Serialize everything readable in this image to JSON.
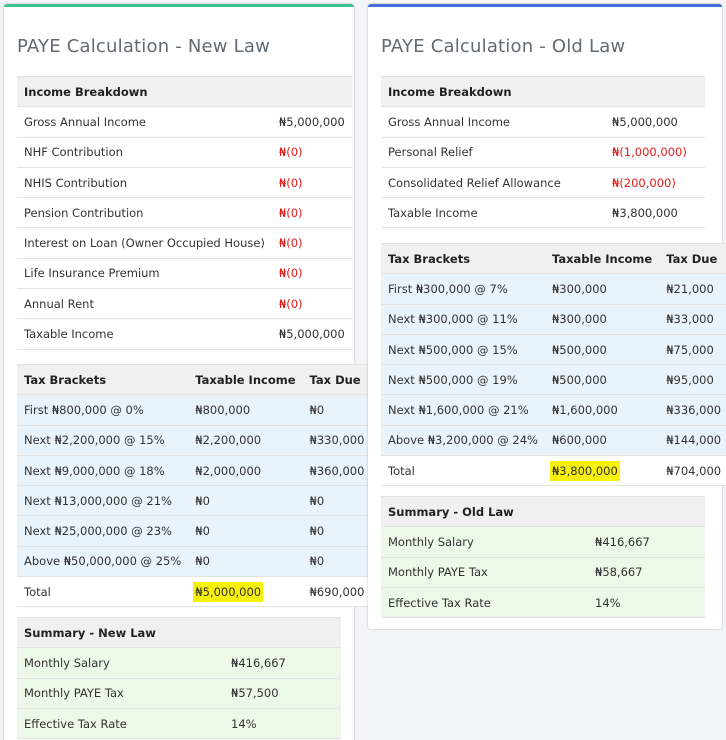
{
  "new_law": {
    "title": "PAYE Calculation - New Law",
    "income": {
      "header": "Income Breakdown",
      "rows": [
        {
          "label": "Gross Annual Income",
          "value": "₦5,000,000"
        },
        {
          "label": "NHF Contribution",
          "value": "₦(0)"
        },
        {
          "label": "NHIS Contribution",
          "value": "₦(0)"
        },
        {
          "label": "Pension Contribution",
          "value": "₦(0)"
        },
        {
          "label": "Interest on Loan (Owner Occupied House)",
          "value": "₦(0)"
        },
        {
          "label": "Life Insurance Premium",
          "value": "₦(0)"
        },
        {
          "label": "Annual Rent",
          "value": "₦(0)"
        },
        {
          "label": "Taxable Income",
          "value": "₦5,000,000"
        }
      ]
    },
    "brackets": {
      "headers": [
        "Tax Brackets",
        "Taxable Income",
        "Tax Due"
      ],
      "rows": [
        {
          "bracket": "First ₦800,000 @ 0%",
          "taxable": "₦800,000",
          "due": "₦0"
        },
        {
          "bracket": "Next ₦2,200,000 @ 15%",
          "taxable": "₦2,200,000",
          "due": "₦330,000"
        },
        {
          "bracket": "Next ₦9,000,000 @ 18%",
          "taxable": "₦2,000,000",
          "due": "₦360,000"
        },
        {
          "bracket": "Next ₦13,000,000 @ 21%",
          "taxable": "₦0",
          "due": "₦0"
        },
        {
          "bracket": "Next ₦25,000,000 @ 23%",
          "taxable": "₦0",
          "due": "₦0"
        },
        {
          "bracket": "Above ₦50,000,000 @ 25%",
          "taxable": "₦0",
          "due": "₦0"
        }
      ],
      "total": {
        "label": "Total",
        "taxable": "₦5,000,000",
        "due": "₦690,000"
      }
    },
    "summary": {
      "header": "Summary - New Law",
      "rows": [
        {
          "label": "Monthly Salary",
          "value": "₦416,667"
        },
        {
          "label": "Monthly PAYE Tax",
          "value": "₦57,500"
        },
        {
          "label": "Effective Tax Rate",
          "value": "14%"
        }
      ]
    }
  },
  "old_law": {
    "title": "PAYE Calculation - Old Law",
    "income": {
      "header": "Income Breakdown",
      "rows": [
        {
          "label": "Gross Annual Income",
          "value": "₦5,000,000"
        },
        {
          "label": "Personal Relief",
          "value": "₦(1,000,000)"
        },
        {
          "label": "Consolidated Relief Allowance",
          "value": "₦(200,000)"
        },
        {
          "label": "Taxable Income",
          "value": "₦3,800,000"
        }
      ]
    },
    "brackets": {
      "headers": [
        "Tax Brackets",
        "Taxable Income",
        "Tax Due"
      ],
      "rows": [
        {
          "bracket": "First ₦300,000 @ 7%",
          "taxable": "₦300,000",
          "due": "₦21,000"
        },
        {
          "bracket": "Next ₦300,000 @ 11%",
          "taxable": "₦300,000",
          "due": "₦33,000"
        },
        {
          "bracket": "Next ₦500,000 @ 15%",
          "taxable": "₦500,000",
          "due": "₦75,000"
        },
        {
          "bracket": "Next ₦500,000 @ 19%",
          "taxable": "₦500,000",
          "due": "₦95,000"
        },
        {
          "bracket": "Next ₦1,600,000 @ 21%",
          "taxable": "₦1,600,000",
          "due": "₦336,000"
        },
        {
          "bracket": "Above ₦3,200,000 @ 24%",
          "taxable": "₦600,000",
          "due": "₦144,000"
        }
      ],
      "total": {
        "label": "Total",
        "taxable": "₦3,800,000",
        "due": "₦704,000"
      }
    },
    "summary": {
      "header": "Summary - Old Law",
      "rows": [
        {
          "label": "Monthly Salary",
          "value": "₦416,667"
        },
        {
          "label": "Monthly PAYE Tax",
          "value": "₦58,667"
        },
        {
          "label": "Effective Tax Rate",
          "value": "14%"
        }
      ]
    }
  },
  "colors": {
    "new_accent": "#3cc28e",
    "old_accent": "#3f6fd8",
    "negative": "#e21b1b",
    "bracket_bg": "#e9f3fb",
    "summary_bg": "#ecf9e8",
    "highlight": "#f7f10a"
  }
}
